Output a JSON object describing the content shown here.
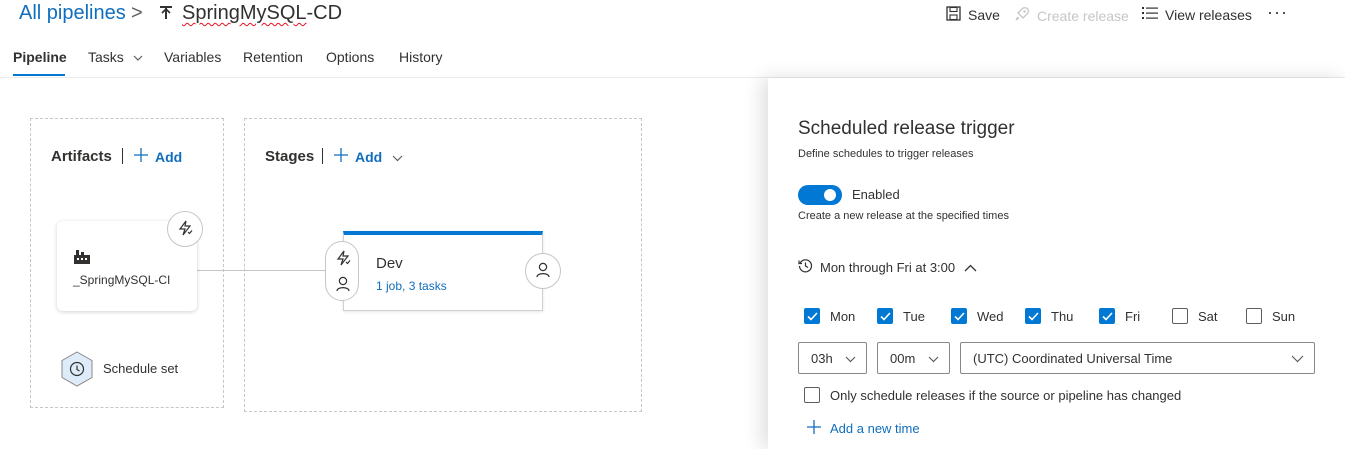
{
  "header": {
    "root_crumb": "All pipelines",
    "separator": ">",
    "title_spell": "SpringMySQL",
    "title_rest": "-CD",
    "save_label": "Save",
    "create_label": "Create release",
    "view_label": "View releases",
    "more_label": "···"
  },
  "tabs": [
    {
      "label": "Pipeline",
      "active": true
    },
    {
      "label": "Tasks"
    },
    {
      "label": "Variables"
    },
    {
      "label": "Retention"
    },
    {
      "label": "Options"
    },
    {
      "label": "History"
    }
  ],
  "canvas": {
    "artifacts_title": "Artifacts",
    "artifacts_add": "Add",
    "stages_title": "Stages",
    "stages_add": "Add",
    "artifact_name": "_SpringMySQL-CI",
    "stage_name": "Dev",
    "stage_sub": "1 job, 3 tasks",
    "schedule_label": "Schedule set"
  },
  "panel": {
    "title": "Scheduled release trigger",
    "subtitle": "Define schedules to trigger releases",
    "toggle_label": "Enabled",
    "toggle_desc": "Create a new release at the specified times",
    "summary": "Mon through Fri at 3:00",
    "days": [
      {
        "label": "Mon",
        "checked": true
      },
      {
        "label": "Tue",
        "checked": true
      },
      {
        "label": "Wed",
        "checked": true
      },
      {
        "label": "Thu",
        "checked": true
      },
      {
        "label": "Fri",
        "checked": true
      },
      {
        "label": "Sat",
        "checked": false
      },
      {
        "label": "Sun",
        "checked": false
      }
    ],
    "hour": "03h",
    "minute": "00m",
    "timezone": "(UTC) Coordinated Universal Time",
    "only_changed_label": "Only schedule releases if the source or pipeline has changed",
    "add_time_label": "Add a new time"
  },
  "colors": {
    "accent": "#0078d4",
    "link": "#106ebe",
    "disabled": "#c8c6c4"
  }
}
